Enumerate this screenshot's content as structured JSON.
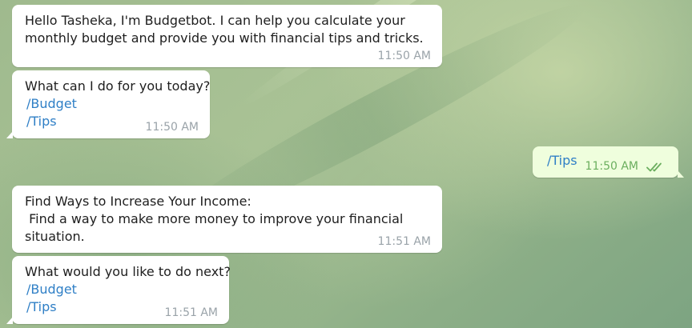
{
  "messages": [
    {
      "lines": [
        "Hello Tasheka, I'm Budgetbot. I can help you calculate your",
        "monthly budget and provide you with financial tips and tricks."
      ],
      "time": "11:50 AM"
    },
    {
      "lines": [
        "What can I do for you today?"
      ],
      "links": [
        "/Budget",
        "/Tips"
      ],
      "time": "11:50 AM"
    },
    {
      "text": "/Tips",
      "time": "11:50 AM",
      "status_icon": "double-check-icon"
    },
    {
      "lines": [
        "Find Ways to Increase Your Income:",
        " Find a way to make more money to improve your financial",
        "situation."
      ],
      "time": "11:51 AM"
    },
    {
      "lines": [
        "What would you like to do next?"
      ],
      "links": [
        "/Budget",
        "/Tips"
      ],
      "time": "11:51 AM"
    }
  ],
  "colors": {
    "incoming_bubble": "#ffffff",
    "outgoing_bubble": "#effedd",
    "link": "#2f7fc6",
    "outgoing_time": "#6bae5e",
    "timestamp": "#9aa3a9"
  }
}
